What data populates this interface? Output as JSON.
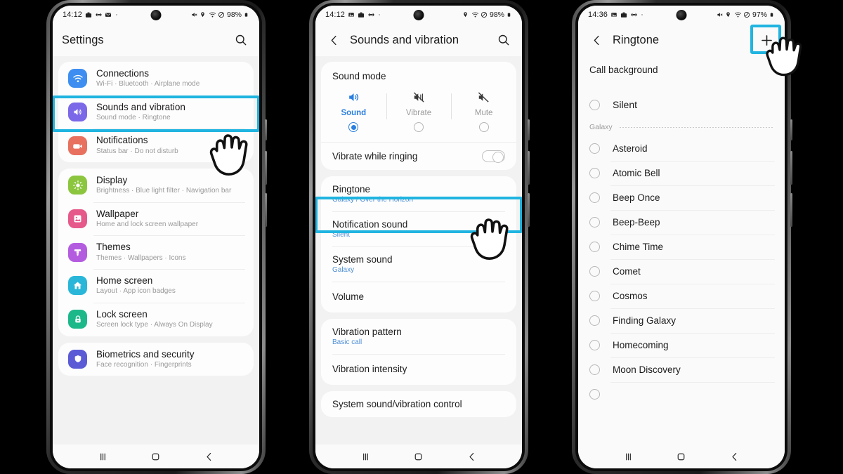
{
  "phones": [
    {
      "id": "settings",
      "status": {
        "time": "14:12",
        "left_icons": [
          "briefcase-icon",
          "dual-sim-icon",
          "mail-icon",
          "dot-icon"
        ],
        "right_icons": [
          "mute-icon",
          "location-icon",
          "wifi-icon",
          "dnd-icon"
        ],
        "battery": "98%"
      },
      "appbar": {
        "title": "Settings",
        "search_icon": "search-icon"
      },
      "groups": [
        {
          "items": [
            {
              "title": "Connections",
              "sub": "Wi-Fi  ·  Bluetooth  ·  Airplane mode",
              "icon": "wifi-icon",
              "color": "#3d8ef0",
              "highlighted": false
            },
            {
              "title": "Sounds and vibration",
              "sub": "Sound mode  ·  Ringtone",
              "icon": "speaker-icon",
              "color": "#7b68e8",
              "highlighted": true
            },
            {
              "title": "Notifications",
              "sub": "Status bar  ·  Do not disturb",
              "icon": "bell-icon",
              "color": "#e8705f",
              "highlighted": false
            }
          ]
        },
        {
          "items": [
            {
              "title": "Display",
              "sub": "Brightness  ·  Blue light filter  ·  Navigation bar",
              "icon": "brightness-icon",
              "color": "#8cc63f",
              "highlighted": false
            },
            {
              "title": "Wallpaper",
              "sub": "Home and lock screen wallpaper",
              "icon": "image-icon",
              "color": "#e55a8a",
              "highlighted": false
            },
            {
              "title": "Themes",
              "sub": "Themes  ·  Wallpapers  ·  Icons",
              "icon": "brush-icon",
              "color": "#b45ce0",
              "highlighted": false
            },
            {
              "title": "Home screen",
              "sub": "Layout  ·  App icon badges",
              "icon": "home-icon",
              "color": "#29b6d8",
              "highlighted": false
            },
            {
              "title": "Lock screen",
              "sub": "Screen lock type  ·  Always On Display",
              "icon": "lock-icon",
              "color": "#1db88a",
              "highlighted": false
            }
          ]
        },
        {
          "items": [
            {
              "title": "Biometrics and security",
              "sub": "Face recognition  ·  Fingerprints",
              "icon": "shield-icon",
              "color": "#5b5bd6",
              "highlighted": false
            }
          ]
        }
      ],
      "nav": [
        "recents-icon",
        "home-icon",
        "back-icon"
      ]
    },
    {
      "id": "sounds-and-vibration",
      "status": {
        "time": "14:12",
        "left_icons": [
          "image-icon",
          "briefcase-icon",
          "dual-sim-icon",
          "dot-icon"
        ],
        "right_icons": [
          "location-icon",
          "wifi-icon",
          "dnd-icon"
        ],
        "battery": "98%"
      },
      "appbar": {
        "back_icon": "back-chevron-icon",
        "title": "Sounds and vibration",
        "search_icon": "search-icon"
      },
      "sound_mode": {
        "label": "Sound mode",
        "options": [
          {
            "name": "Sound",
            "icon": "speaker-on-icon",
            "selected": true
          },
          {
            "name": "Vibrate",
            "icon": "vibrate-icon",
            "selected": false
          },
          {
            "name": "Mute",
            "icon": "speaker-mute-icon",
            "selected": false
          }
        ]
      },
      "vibrate_while_ringing": {
        "title": "Vibrate while ringing",
        "toggle_on": false
      },
      "items": [
        {
          "title": "Ringtone",
          "sub": "Galaxy / Over the Horizon",
          "highlighted": true
        },
        {
          "title": "Notification sound",
          "sub": "Silent",
          "highlighted": false
        },
        {
          "title": "System sound",
          "sub": "Galaxy",
          "highlighted": false
        },
        {
          "title": "Volume",
          "sub": "",
          "highlighted": false
        }
      ],
      "items2": [
        {
          "title": "Vibration pattern",
          "sub": "Basic call"
        },
        {
          "title": "Vibration intensity",
          "sub": ""
        }
      ],
      "items3": [
        {
          "title": "System sound/vibration control",
          "sub": ""
        }
      ],
      "nav": [
        "recents-icon",
        "home-icon",
        "back-icon"
      ]
    },
    {
      "id": "ringtone",
      "status": {
        "time": "14:36",
        "left_icons": [
          "image-icon",
          "briefcase-icon",
          "dual-sim-icon",
          "dot-icon"
        ],
        "right_icons": [
          "mute-icon",
          "location-icon",
          "wifi-icon",
          "dnd-icon"
        ],
        "battery": "97%"
      },
      "appbar": {
        "back_icon": "back-chevron-icon",
        "title": "Ringtone",
        "add_icon": "plus-icon",
        "add_highlighted": true
      },
      "call_background": "Call background",
      "top_item": {
        "name": "Silent",
        "selected": false
      },
      "group_label": "Galaxy",
      "tones": [
        {
          "name": "Asteroid",
          "selected": false
        },
        {
          "name": "Atomic Bell",
          "selected": false
        },
        {
          "name": "Beep Once",
          "selected": false
        },
        {
          "name": "Beep-Beep",
          "selected": false
        },
        {
          "name": "Chime Time",
          "selected": false
        },
        {
          "name": "Comet",
          "selected": false
        },
        {
          "name": "Cosmos",
          "selected": false
        },
        {
          "name": "Finding Galaxy",
          "selected": false
        },
        {
          "name": "Homecoming",
          "selected": false
        },
        {
          "name": "Moon Discovery",
          "selected": false
        }
      ],
      "nav": [
        "recents-icon",
        "home-icon",
        "back-icon"
      ]
    }
  ],
  "theme": {
    "highlight": "#20b4e0",
    "accent_blue": "#2b7fe0",
    "sub_blue": "#4e8fd6"
  }
}
